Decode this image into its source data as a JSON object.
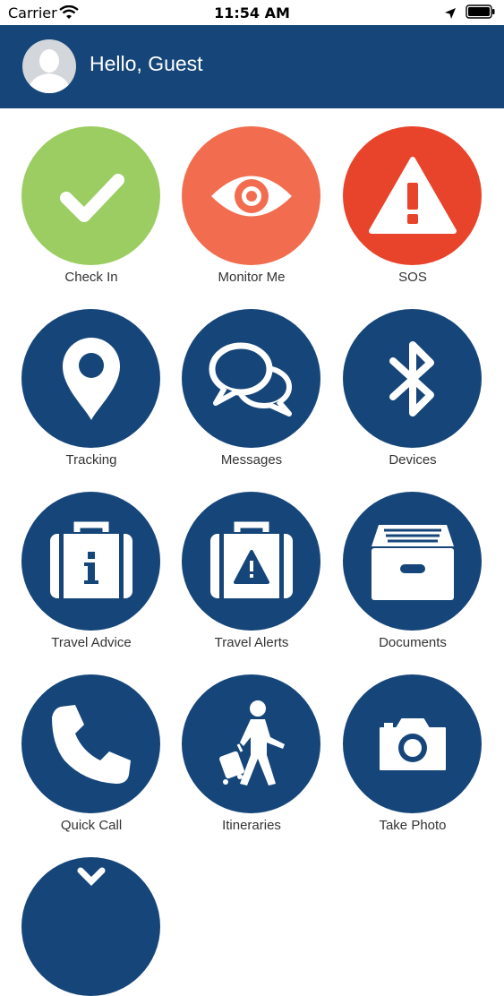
{
  "status_bar": {
    "carrier": "Carrier",
    "time": "11:54 AM"
  },
  "header": {
    "greeting": "Hello, Guest"
  },
  "tiles": [
    {
      "label": "Check In",
      "icon": "checkmark-icon",
      "color": "#9ccd62"
    },
    {
      "label": "Monitor Me",
      "icon": "eye-icon",
      "color": "#f26d50"
    },
    {
      "label": "SOS",
      "icon": "warning-icon",
      "color": "#e8442c"
    },
    {
      "label": "Tracking",
      "icon": "map-pin-icon",
      "color": "#164679"
    },
    {
      "label": "Messages",
      "icon": "chat-bubbles-icon",
      "color": "#164679"
    },
    {
      "label": "Devices",
      "icon": "bluetooth-icon",
      "color": "#164679"
    },
    {
      "label": "Travel Advice",
      "icon": "suitcase-info-icon",
      "color": "#164679"
    },
    {
      "label": "Travel Alerts",
      "icon": "suitcase-alert-icon",
      "color": "#164679"
    },
    {
      "label": "Documents",
      "icon": "file-box-icon",
      "color": "#164679"
    },
    {
      "label": "Quick Call",
      "icon": "phone-icon",
      "color": "#164679"
    },
    {
      "label": "Itineraries",
      "icon": "traveler-icon",
      "color": "#164679"
    },
    {
      "label": "Take Photo",
      "icon": "camera-icon",
      "color": "#164679"
    },
    {
      "label": "",
      "icon": "partial-icon",
      "color": "#164679"
    }
  ]
}
